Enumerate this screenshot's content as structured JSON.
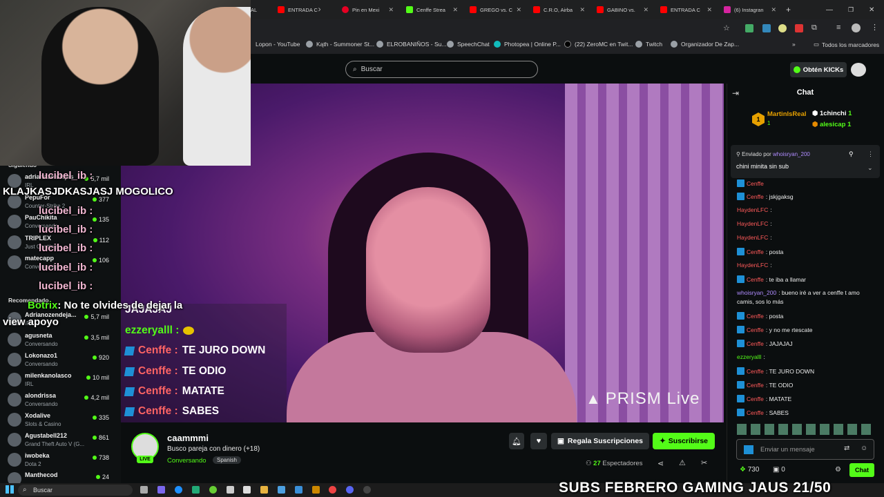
{
  "browser": {
    "tabs": [
      {
        "label": "AL",
        "color": "#ff0000"
      },
      {
        "label": "ENTRADA C",
        "color": "#ff0000"
      },
      {
        "label": "Pin en Mexi",
        "color": "#e60023"
      },
      {
        "label": "Cenffe Strea",
        "color": "#53fc18"
      },
      {
        "label": "GREGO vs. C",
        "color": "#ff0000"
      },
      {
        "label": "C.R.O, Airba",
        "color": "#ff0000"
      },
      {
        "label": "GABINO vs.",
        "color": "#ff0000"
      },
      {
        "label": "ENTRADA C",
        "color": "#ff0000"
      },
      {
        "label": "(6) Instagran",
        "color": "#d6249f"
      }
    ],
    "new_tab": "+",
    "bookmarks": [
      "Lopon - YouTube",
      "Kąth - Summoner St...",
      "ELROBANIÑOS - Su...",
      "SpeechChat",
      "Photopea | Online P...",
      "(22) ZeroMC en Twit...",
      "Twitch",
      "Organizador De Zap..."
    ],
    "bookmarks_more": "»",
    "all_bookmarks": "Todos los marcadores"
  },
  "kick": {
    "search_placeholder": "Buscar",
    "kicks_button": "Obtén KICKs"
  },
  "sidebar": {
    "following_header": "Siguiendo",
    "recommended_header": "Recomendado",
    "following": [
      {
        "name": "adrianozendejas",
        "category": "IRL",
        "viewers": "5,7 mil"
      },
      {
        "name": "PepuFor",
        "category": "Counter-Strike 2",
        "viewers": "377"
      },
      {
        "name": "PauChikita",
        "category": "Conversando",
        "viewers": "135"
      },
      {
        "name": "TRIPLEX",
        "category": "Just Chatting",
        "viewers": "112"
      },
      {
        "name": "matecapp",
        "category": "Conversando",
        "viewers": "106"
      }
    ],
    "recommended": [
      {
        "name": "Adrianozendeja...",
        "category": "IRL",
        "viewers": "5,7 mil"
      },
      {
        "name": "agusneta",
        "category": "Conversando",
        "viewers": "3,5 mil"
      },
      {
        "name": "Lokonazo1",
        "category": "Conversando",
        "viewers": "920"
      },
      {
        "name": "milenkanolasco",
        "category": "IRL",
        "viewers": "10 mil"
      },
      {
        "name": "alondrissa",
        "category": "Conversando",
        "viewers": "4,2 mil"
      },
      {
        "name": "Xodalive",
        "category": "Slots & Casino",
        "viewers": "335"
      },
      {
        "name": "Agustabell212",
        "category": "Grand Theft Auto V (G...",
        "viewers": "861"
      },
      {
        "name": "iwobeka",
        "category": "Dota 2",
        "viewers": "738"
      },
      {
        "name": "Manthecod",
        "category": "",
        "viewers": "24"
      }
    ]
  },
  "overlay": {
    "top_message": "KLAJKASJDKASJASJ MOGOLICO",
    "repeat_name": "lucibel_ib :",
    "botrix_name": "Botrix",
    "botrix_msg": ": No te olvides de dejar la",
    "botrix_msg2": "view apoyo",
    "banner": "SUBS FEBRERO GAMING JAUS 21/50"
  },
  "video_chat": [
    {
      "name": "",
      "text": "JAJAJAJ"
    },
    {
      "name": "ezzeryalll :",
      "text": "",
      "emote": true
    },
    {
      "name": "Cenffe :",
      "text": "TE JURO DOWN"
    },
    {
      "name": "Cenffe :",
      "text": "TE ODIO"
    },
    {
      "name": "Cenffe :",
      "text": "MATATE"
    },
    {
      "name": "Cenffe :",
      "text": "SABES"
    }
  ],
  "prism": "PRISM Live",
  "stream": {
    "live_label": "LIVE",
    "channel": "caammmi",
    "title": "Busco pareja con dinero (+18)",
    "category": "Conversando",
    "language": "Spanish",
    "gift_button": "Regala Suscripciones",
    "subscribe_button": "Suscribirse",
    "viewers_count": "27",
    "viewers_label": "Espectadores"
  },
  "chat": {
    "title": "Chat",
    "top_gifters": [
      {
        "rank": "1",
        "name": "MartinIsReal",
        "count": "1"
      },
      {
        "name": "1chinchi",
        "count": "1"
      },
      {
        "name": "alesicap",
        "count": "1"
      }
    ],
    "pinned_label": "Enviado por",
    "pinned_user": "whoisryan_200",
    "pinned_text": "chini minita sin sub",
    "messages": [
      {
        "user": "Cenffe",
        "text": "",
        "style": "cu"
      },
      {
        "user": "Cenffe",
        "text": ": jskjgaksg",
        "style": "cu"
      },
      {
        "user": "HaydenLFC",
        "text": ":",
        "style": "cu"
      },
      {
        "user": "HaydenLFC",
        "text": ":",
        "style": "cu"
      },
      {
        "user": "HaydenLFC",
        "text": ":",
        "style": "cu"
      },
      {
        "user": "Cenffe",
        "text": ": posta",
        "style": "cu"
      },
      {
        "user": "HaydenLFC",
        "text": ":",
        "style": "cu"
      },
      {
        "user": "Cenffe",
        "text": ": te iba a llamar",
        "style": "cu"
      },
      {
        "user": "whoisryan_200",
        "text": ": bueno iré a ver a cenffe t amo",
        "style": "cu2"
      },
      {
        "user": "",
        "text": "camis, sos lo más",
        "style": "cu2"
      },
      {
        "user": "Cenffe",
        "text": ": posta",
        "style": "cu"
      },
      {
        "user": "Cenffe",
        "text": ": y no me rtescate",
        "style": "cu"
      },
      {
        "user": "Cenffe",
        "text": ": JAJAJAJ",
        "style": "cu"
      },
      {
        "user": "ezzeryalll",
        "text": ":",
        "style": "cu3"
      },
      {
        "user": "Cenffe",
        "text": ": TE JURO DOWN",
        "style": "cu"
      },
      {
        "user": "Cenffe",
        "text": ": TE ODIO",
        "style": "cu"
      },
      {
        "user": "Cenffe",
        "text": ": MATATE",
        "style": "cu"
      },
      {
        "user": "Cenffe",
        "text": ": SABES",
        "style": "cu"
      }
    ],
    "input_placeholder": "Enviar un mensaje",
    "points": "730",
    "drops": "0",
    "chat_button": "Chat"
  },
  "taskbar": {
    "search": "Buscar"
  },
  "colors": {
    "kick_green": "#53fc18",
    "chat_red": "#ff5a5a"
  }
}
